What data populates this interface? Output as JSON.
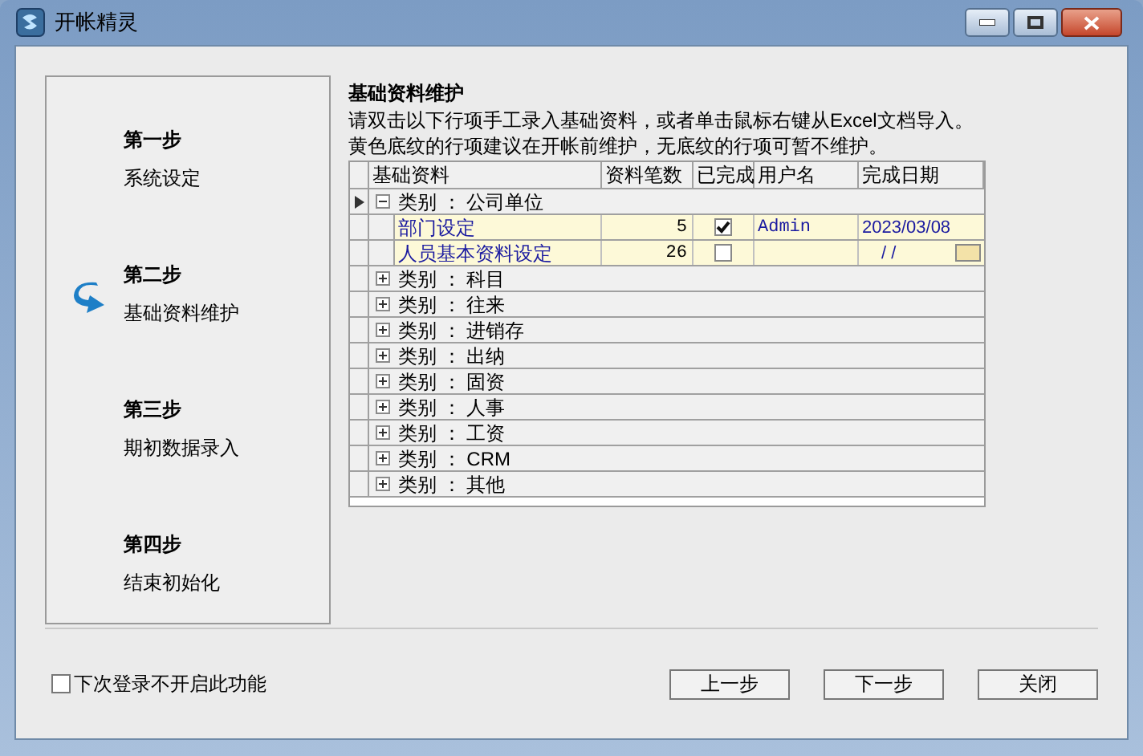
{
  "window": {
    "title": "开帐精灵"
  },
  "steps": [
    {
      "label": "第一步",
      "name": "系统设定",
      "selected": false
    },
    {
      "label": "第二步",
      "name": "基础资料维护",
      "selected": true
    },
    {
      "label": "第三步",
      "name": "期初数据录入",
      "selected": false
    },
    {
      "label": "第四步",
      "name": "结束初始化",
      "selected": false
    }
  ],
  "section": {
    "title": "基础资料维护",
    "instructions": [
      "请双击以下行项手工录入基础资料，或者单击鼠标右键从Excel文档导入。",
      "黄色底纹的行项建议在开帐前维护，无底纹的行项可暂不维护。"
    ]
  },
  "table": {
    "columns": [
      "基础资料",
      "资料笔数",
      "已完成",
      "用户名",
      "完成日期"
    ],
    "rows": [
      {
        "kind": "category",
        "label": "类别 ： 公司单位",
        "expanded": true,
        "selected": true
      },
      {
        "kind": "item",
        "name": "部门设定",
        "count": "5",
        "done": true,
        "user": "Admin",
        "date": "2023/03/08",
        "highlighted": true,
        "selected": false
      },
      {
        "kind": "item",
        "name": "人员基本资料设定",
        "count": "26",
        "done": false,
        "date": "/ /",
        "highlighted": true,
        "selected": false
      },
      {
        "kind": "category",
        "label": "类别 ： 科目",
        "expanded": false,
        "selected": false
      },
      {
        "kind": "category",
        "label": "类别 ： 往来",
        "expanded": false,
        "selected": false
      },
      {
        "kind": "category",
        "label": "类别 ： 进销存",
        "expanded": false,
        "selected": false
      },
      {
        "kind": "category",
        "label": "类别 ： 出纳",
        "expanded": false,
        "selected": false
      },
      {
        "kind": "category",
        "label": "类别 ： 固资",
        "expanded": false,
        "selected": false
      },
      {
        "kind": "category",
        "label": "类别 ： 人事",
        "expanded": false,
        "selected": false
      },
      {
        "kind": "category",
        "label": "类别 ： 工资",
        "expanded": false,
        "selected": false
      },
      {
        "kind": "category",
        "label": "类别 ： CRM",
        "expanded": false,
        "selected": false
      },
      {
        "kind": "category",
        "label": "类别 ： 其他",
        "expanded": false,
        "selected": false
      }
    ]
  },
  "footer": {
    "checkbox": {
      "label": "下次登录不开启此功能",
      "checked": false
    },
    "buttons": [
      "上一步",
      "下一步",
      "关闭"
    ]
  }
}
